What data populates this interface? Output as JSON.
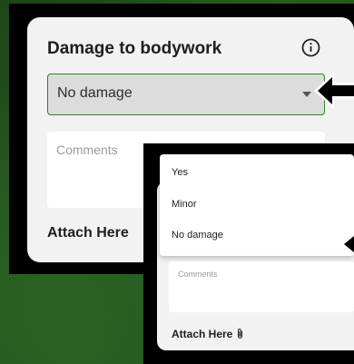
{
  "field": {
    "title": "Damage to bodywork",
    "selected_value": "No damage",
    "comments_placeholder": "Comments",
    "attach_label": "Attach Here"
  },
  "dropdown": {
    "options": [
      "Yes",
      "Minor",
      "No damage"
    ]
  },
  "zoom": {
    "comments_placeholder": "Comments",
    "attach_label": "Attach Here"
  },
  "icons": {
    "info": "info-circle-icon",
    "caret": "caret-down-icon",
    "attach": "paperclip-icon",
    "pointer": "arrow-left-icon"
  },
  "colors": {
    "background": "#1f4d1a",
    "select_border": "#3a7a35",
    "card": "#f2f2f2"
  }
}
